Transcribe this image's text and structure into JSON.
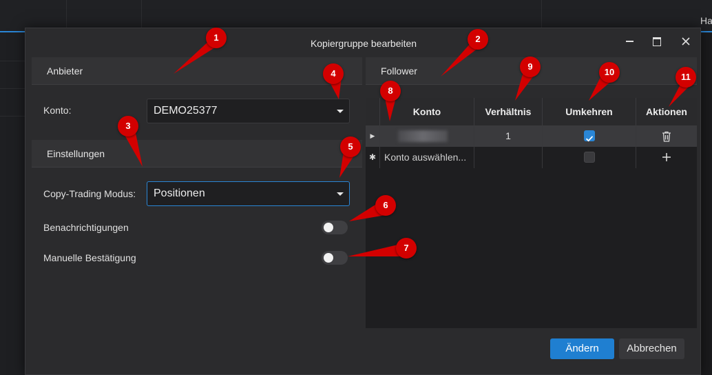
{
  "background": {
    "top_right_text": "Ha"
  },
  "dialog": {
    "title": "Kopiergruppe bearbeiten",
    "provider": {
      "header": "Anbieter",
      "account_label": "Konto:",
      "account_value": "DEMO25377"
    },
    "settings": {
      "header": "Einstellungen",
      "mode_label": "Copy-Trading Modus:",
      "mode_value": "Positionen",
      "notifications_label": "Benachrichtigungen",
      "notifications_on": false,
      "manual_confirm_label": "Manuelle Bestätigung",
      "manual_confirm_on": false
    },
    "follower": {
      "header": "Follower",
      "columns": [
        "Konto",
        "Verhältnis",
        "Umkehren",
        "Aktionen"
      ],
      "rows": [
        {
          "konto": "",
          "ratio": "1",
          "invert": true
        },
        {
          "konto": "Konto auswählen...",
          "ratio": "",
          "invert": false
        }
      ]
    },
    "buttons": {
      "apply": "Ändern",
      "cancel": "Abbrechen"
    }
  },
  "annotations": [
    "1",
    "2",
    "3",
    "4",
    "5",
    "6",
    "7",
    "8",
    "9",
    "10",
    "11"
  ],
  "colors": {
    "accent": "#2a86d6",
    "marker": "#d30000",
    "primary_button": "#1f7fd1"
  }
}
